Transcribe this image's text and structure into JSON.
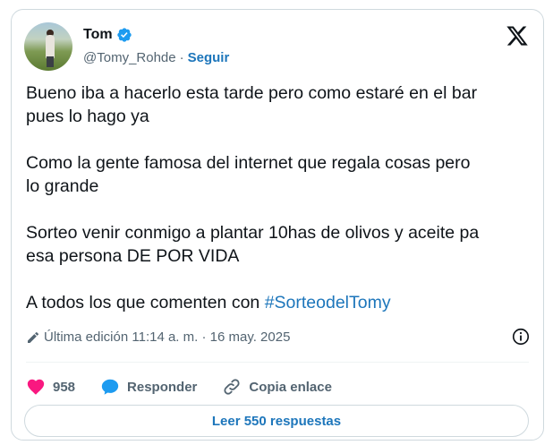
{
  "author": {
    "name": "Tom",
    "handle": "@Tomy_Rohde",
    "separator": "·",
    "follow_label": "Seguir"
  },
  "tweet": {
    "paragraphs": [
      "Bueno iba a hacerlo esta tarde pero como estaré en el bar\npues lo hago ya",
      "Como la gente famosa del internet que regala cosas pero\nlo grande",
      "Sorteo venir conmigo a plantar 10has de olivos y aceite pa\nesa persona DE POR VIDA"
    ],
    "last_line_prefix": "A todos los que comenten con ",
    "hashtag": "#SorteodelTomy"
  },
  "meta": {
    "edited_label": "Última edición 11:14 a. m. · 16 may. 2025"
  },
  "actions": {
    "likes": "958",
    "reply_label": "Responder",
    "copy_link_label": "Copia enlace"
  },
  "read_replies_label": "Leer 550 respuestas",
  "colors": {
    "accent": "#1d76bb",
    "like": "#f91880",
    "verified": "#1d9bf0",
    "muted": "#536471",
    "border": "#cfd9de"
  },
  "icons": [
    "verified-badge-icon",
    "x-logo-icon",
    "pencil-icon",
    "info-icon",
    "heart-icon",
    "reply-bubble-icon",
    "link-icon"
  ]
}
